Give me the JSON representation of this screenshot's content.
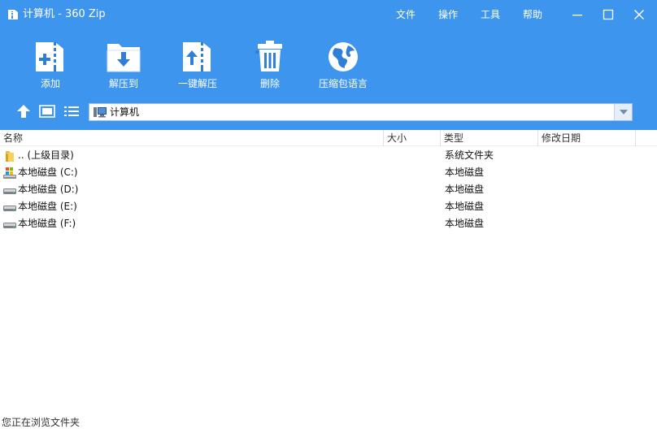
{
  "window": {
    "title": "计算机 - 360 Zip",
    "menu": [
      "文件",
      "操作",
      "工具",
      "帮助"
    ]
  },
  "toolbar": {
    "items": [
      {
        "label": "添加",
        "icon": "add-archive-icon"
      },
      {
        "label": "解压到",
        "icon": "extract-to-icon"
      },
      {
        "label": "一键解压",
        "icon": "one-click-extract-icon"
      },
      {
        "label": "删除",
        "icon": "trash-icon"
      },
      {
        "label": "压缩包语言",
        "icon": "globe-icon"
      }
    ]
  },
  "address": {
    "path": "计算机",
    "icon": "computer-icon"
  },
  "columns": [
    "名称",
    "大小",
    "类型",
    "修改日期"
  ],
  "rows": [
    {
      "name": ".. (上级目录)",
      "size": "",
      "type": "系统文件夹",
      "date": "",
      "icon": "folder-icon"
    },
    {
      "name": "本地磁盘 (C:)",
      "size": "",
      "type": "本地磁盘",
      "date": "",
      "icon": "system-drive-icon"
    },
    {
      "name": "本地磁盘 (D:)",
      "size": "",
      "type": "本地磁盘",
      "date": "",
      "icon": "drive-icon"
    },
    {
      "name": "本地磁盘 (E:)",
      "size": "",
      "type": "本地磁盘",
      "date": "",
      "icon": "drive-icon"
    },
    {
      "name": "本地磁盘 (F:)",
      "size": "",
      "type": "本地磁盘",
      "date": "",
      "icon": "drive-icon"
    }
  ],
  "status": "您正在浏览文件夹",
  "colors": {
    "header_blue": "#3e95ee",
    "icon_blue": "#2f7fd8"
  }
}
